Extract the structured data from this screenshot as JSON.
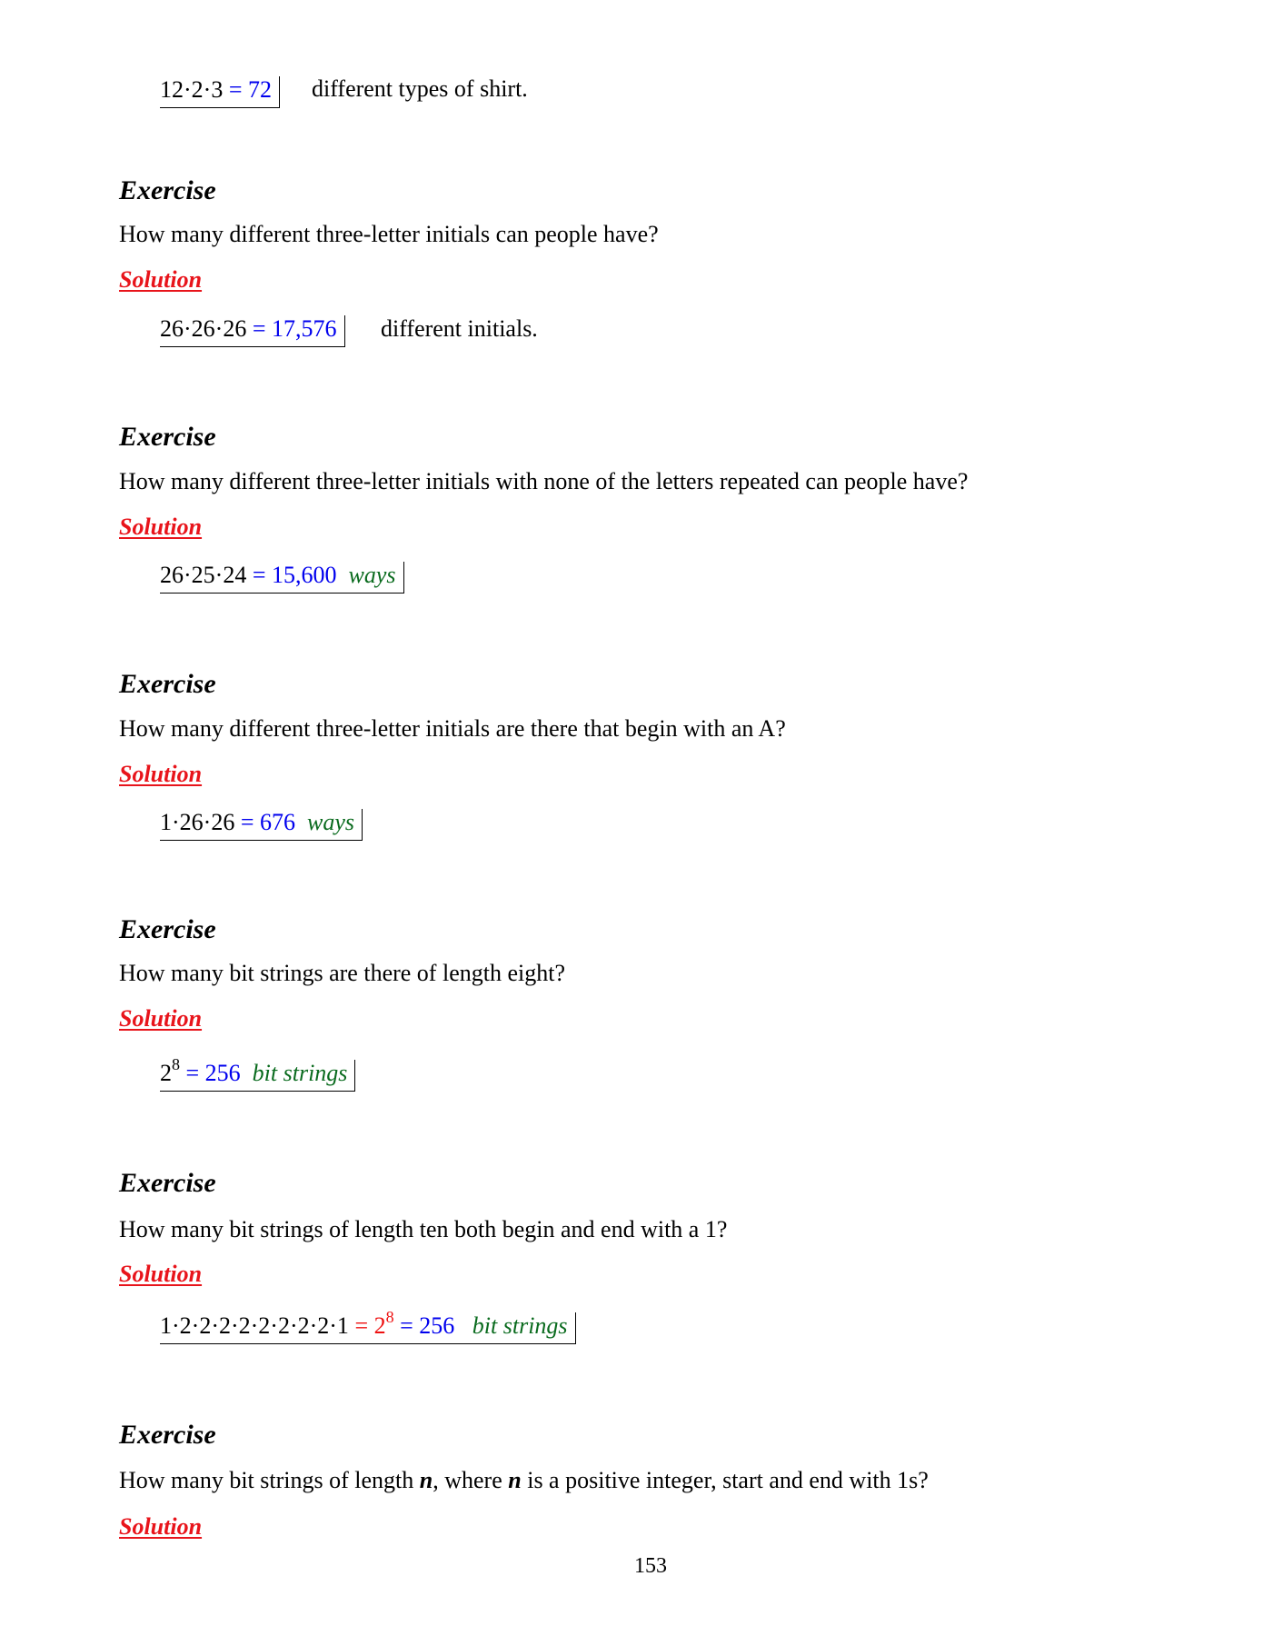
{
  "top": {
    "expr": "12·2·3",
    "result": "= 72",
    "trailing": "different types of shirt."
  },
  "exercises": [
    {
      "title": "Exercise",
      "question": "How many different three-letter initials can people have?",
      "solution_label": "Solution",
      "expr": "26·26·26",
      "result": "= 17,576",
      "trailing": "different initials."
    },
    {
      "title": "Exercise",
      "question": "How many different three-letter initials with none of the letters repeated can people have?",
      "solution_label": "Solution",
      "expr": "26·25·24",
      "result": "= 15,600",
      "unit": "ways"
    },
    {
      "title": "Exercise",
      "question": "How many different three-letter initials are there that begin with an A?",
      "solution_label": "Solution",
      "expr": "1·26·26",
      "result": "= 676",
      "unit": "ways"
    },
    {
      "title": "Exercise",
      "question": "How many bit strings are there of length eight?",
      "solution_label": "Solution",
      "base": "2",
      "exponent": "8",
      "result": "= 256",
      "unit": "bit strings"
    },
    {
      "title": "Exercise",
      "question": "How many bit strings of length ten both begin and end with a 1?",
      "solution_label": "Solution",
      "expr": "1·2·2·2·2·2·2·2·2·1",
      "mid": "= 2",
      "mid_exponent": "8",
      "result": "= 256",
      "unit": "bit strings"
    },
    {
      "title": "Exercise",
      "question_start": "How many bit strings of length ",
      "var1": "n",
      "question_mid": ", where ",
      "var2": "n",
      "question_end": " is a positive integer, start and end with 1s?",
      "solution_label": "Solution"
    }
  ],
  "page_number": "153"
}
